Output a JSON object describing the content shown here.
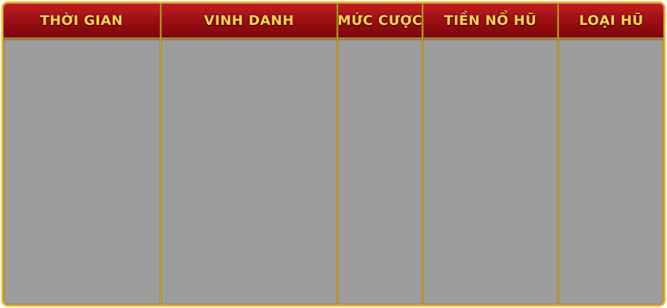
{
  "table": {
    "headers": [
      "THỜI GIAN",
      "VINH DANH",
      "MỨC CƯỢC",
      "TIỀN NỔ HŨ",
      "LOẠI HŨ"
    ],
    "rows": []
  },
  "colors": {
    "header_top": "#c31f24",
    "header_bottom": "#7a0609",
    "header_text": "#ffd84a",
    "border_gold": "#e8b42a",
    "body_gray": "#9d9d9d"
  }
}
